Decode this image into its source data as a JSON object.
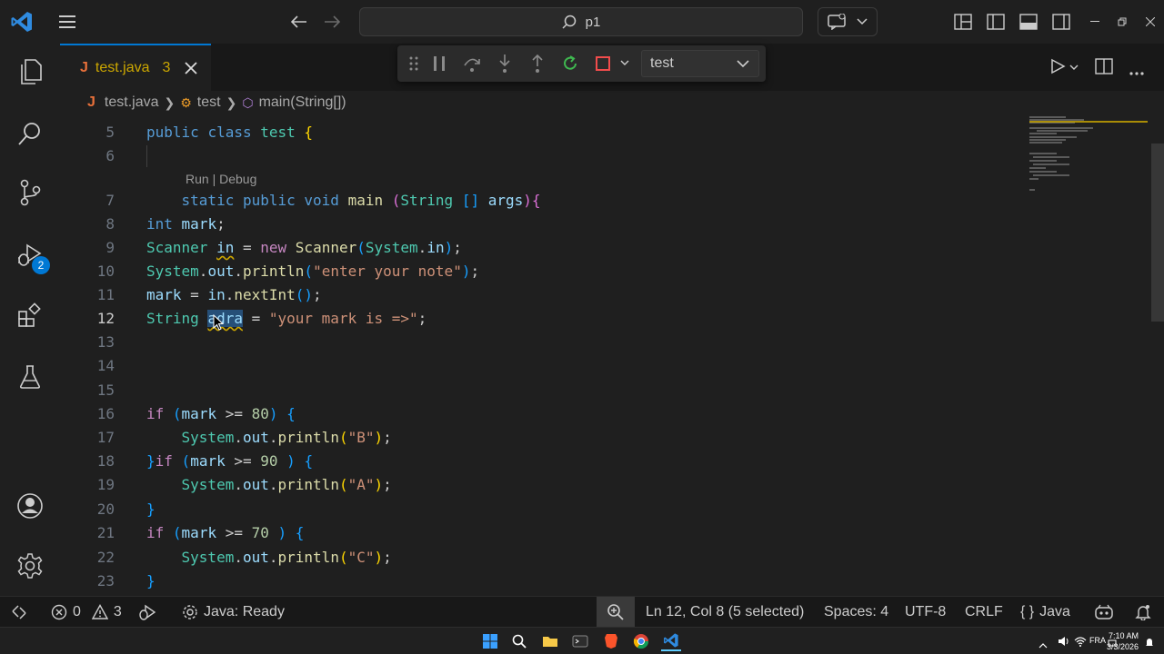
{
  "titlebar": {
    "search_text": "p1"
  },
  "activity": {
    "source_control_badge": "2"
  },
  "tab": {
    "icon_letter": "J",
    "filename": "test.java",
    "problems_count": "3"
  },
  "debug": {
    "config_name": "test"
  },
  "breadcrumb": {
    "file": "test.java",
    "class": "test",
    "method": "main(String[])"
  },
  "editor": {
    "line_numbers": [
      "5",
      "6",
      "7",
      "8",
      "9",
      "10",
      "11",
      "12",
      "13",
      "14",
      "15",
      "16",
      "17",
      "18",
      "19",
      "20",
      "21",
      "22",
      "23"
    ],
    "active_line": "12",
    "codelens": "Run | Debug"
  },
  "status": {
    "errors": "0",
    "warnings": "3",
    "java_status": "Java: Ready",
    "cursor": "Ln 12, Col 8 (5 selected)",
    "spaces": "Spaces: 4",
    "encoding": "UTF-8",
    "eol": "CRLF",
    "language": "Java"
  },
  "taskbar": {
    "lang": "FRA",
    "time": "7:10 AM",
    "date": "3/3/2026"
  },
  "colors": {
    "accent": "#0078d4",
    "warning": "#cca700",
    "java_icon": "#e8703a"
  }
}
